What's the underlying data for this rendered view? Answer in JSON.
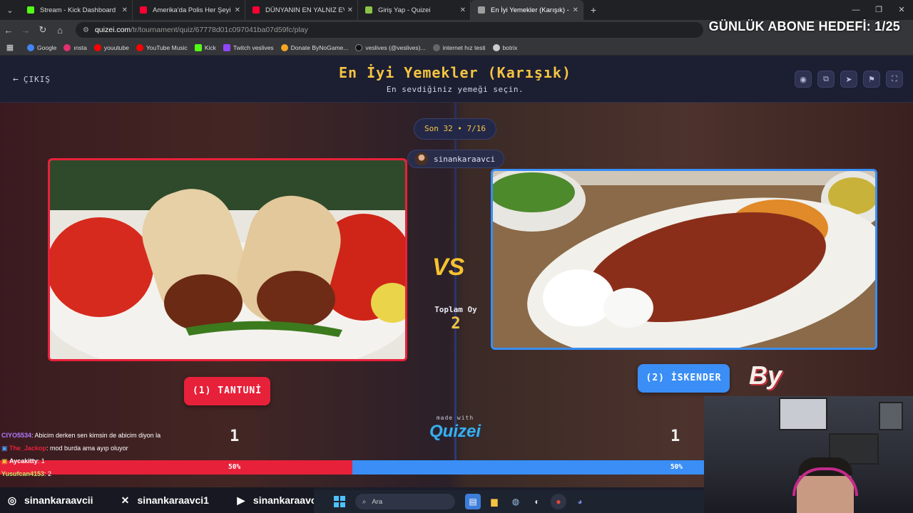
{
  "browser": {
    "tabs": [
      {
        "title": "Stream - Kick Dashboard",
        "color": "#53fc18",
        "active": false
      },
      {
        "title": "Amerika'da Polis Her Şeyi Görü",
        "color": "#ff0033",
        "active": false
      },
      {
        "title": "DÜNYANIN EN YALNIZ EVİNDE",
        "color": "#ff0033",
        "active": false
      },
      {
        "title": "Giriş Yap - Quizei",
        "color": "#8bc34a",
        "active": false
      },
      {
        "title": "En İyi Yemekler (Karışık) - Tier Li",
        "color": "#9e9e9e",
        "active": true
      }
    ],
    "url_host": "quizei.com",
    "url_path": "/tr/tournament/quiz/67778d01c097041ba07d59fc/play",
    "bookmarks": [
      {
        "label": "Google",
        "color": "#4285f4"
      },
      {
        "label": "ınsta",
        "color": "#e1306c"
      },
      {
        "label": "youutube",
        "color": "#ff0000"
      },
      {
        "label": "YouTube Music",
        "color": "#ff0000"
      },
      {
        "label": "Kick",
        "color": "#53fc18"
      },
      {
        "label": "Twitch veslives",
        "color": "#9146ff"
      },
      {
        "label": "Donate ByNoGame...",
        "color": "#f5a623"
      },
      {
        "label": "veslives (@veslives)...",
        "color": "#111111"
      },
      {
        "label": "internet hız testi",
        "color": "#666666"
      },
      {
        "label": "botrix",
        "color": "#cccccc"
      }
    ]
  },
  "overlay": {
    "goal_text": "GÜNLÜK ABONE HEDEFİ: 1/25"
  },
  "quiz": {
    "exit_label": "ÇIKIŞ",
    "title": "En İyi Yemekler (Karışık)",
    "subtitle": "En sevdiğiniz yemeği seçin.",
    "round": "Son 32 • 7/16",
    "host": "sinankaraavci",
    "vs": "VS",
    "total_label": "Toplam Oy",
    "total_value": "2",
    "left": {
      "label": "(1) TANTUNİ",
      "votes": "1",
      "percent_text": "50%",
      "share": 0.5
    },
    "right": {
      "label": "(2) İSKENDER",
      "votes": "1",
      "percent_text": "50%",
      "share": 0.5
    },
    "made_with": "made with",
    "brand": "Quizei",
    "by_logo": "By"
  },
  "chat": [
    {
      "user": "CIYO5534",
      "msg": ": Abicim derken sen kimsin de abicim diyon la",
      "color": "#b07cff"
    },
    {
      "user": "The_Jackop",
      "msg": ": mod burda ama ayıp oluyor",
      "color": "#e8213a"
    },
    {
      "user": "Aycakitty",
      "msg": ": 1",
      "color": "#ffffff"
    },
    {
      "user": "Yusufcan4153",
      "msg": ": 2",
      "color": "#c6e26a"
    }
  ],
  "socials": [
    {
      "icon": "instagram-icon",
      "handle": "sinankaraavcii"
    },
    {
      "icon": "x-icon",
      "handle": "sinankaraavci1"
    },
    {
      "icon": "youtube-icon",
      "handle": "sinankaraavci"
    }
  ],
  "taskbar": {
    "search_placeholder": "Ara"
  }
}
